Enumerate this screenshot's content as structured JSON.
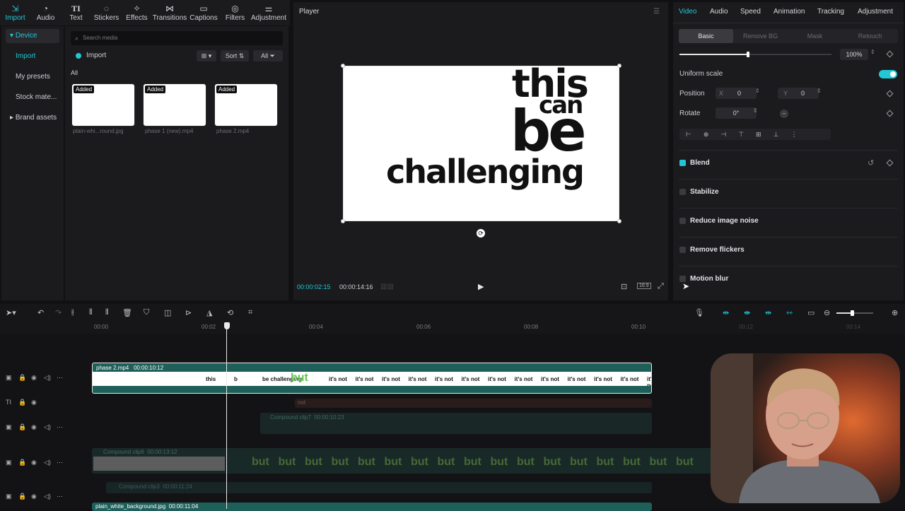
{
  "toolbar": {
    "tabs": [
      {
        "label": "Import",
        "icon": "import-icon"
      },
      {
        "label": "Audio",
        "icon": "audio-icon"
      },
      {
        "label": "Text",
        "icon": "text-icon"
      },
      {
        "label": "Stickers",
        "icon": "stickers-icon"
      },
      {
        "label": "Effects",
        "icon": "effects-icon"
      },
      {
        "label": "Transitions",
        "icon": "transitions-icon"
      },
      {
        "label": "Captions",
        "icon": "captions-icon"
      },
      {
        "label": "Filters",
        "icon": "filters-icon"
      },
      {
        "label": "Adjustment",
        "icon": "adjustment-icon"
      }
    ],
    "active_color": "#22c7d6"
  },
  "sidebar": {
    "items": [
      "Device",
      "Import",
      "My presets",
      "Stock mate...",
      "Brand assets"
    ]
  },
  "media": {
    "search_placeholder": "Search media",
    "import_label": "Import",
    "sort_label": "Sort",
    "all_filter_label": "All",
    "section_label": "All",
    "items": [
      {
        "name": "plain-whi...round.jpg",
        "badge": "Added"
      },
      {
        "name": "phase 1 (new).mp4",
        "badge": "Added"
      },
      {
        "name": "phase 2.mp4",
        "badge": "Added"
      }
    ]
  },
  "player": {
    "title": "Player",
    "current_time": "00:00:02:15",
    "total_time": "00:00:14:16",
    "aspect_label": "16:9",
    "canvas_text": [
      "this",
      "can",
      "be",
      "challenging"
    ]
  },
  "inspector": {
    "tabs": [
      "Video",
      "Audio",
      "Speed",
      "Animation",
      "Tracking",
      "Adjustment"
    ],
    "subtabs": [
      "Basic",
      "Remove BG",
      "Mask",
      "Retouch"
    ],
    "scale_value": "100%",
    "scale_level": 0.45,
    "uniform_scale_label": "Uniform scale",
    "position_label": "Position",
    "position_x_label": "X",
    "position_x": "0",
    "position_y_label": "Y",
    "position_y": "0",
    "rotate_label": "Rotate",
    "rotate_value": "0°",
    "sections": [
      {
        "label": "Blend",
        "checked": true
      },
      {
        "label": "Stabilize",
        "checked": false
      },
      {
        "label": "Reduce image noise",
        "checked": false
      },
      {
        "label": "Remove flickers",
        "checked": false
      },
      {
        "label": "Motion blur",
        "checked": false
      }
    ]
  },
  "timeline": {
    "ruler": [
      "00:00",
      "00:02",
      "00:04",
      "00:06",
      "00:08",
      "00:10",
      "00:12",
      "00:14"
    ],
    "main_clip": {
      "name": "phase 2.mp4",
      "duration": "00:00:10:12"
    },
    "text_clip": "not",
    "compound7": {
      "name": "Compound clip7",
      "duration": "00:00:10:23"
    },
    "compound6": {
      "name": "Compound clip6",
      "duration": "00:00:13:12"
    },
    "compound3": {
      "name": "Compound clip3",
      "duration": "00:00:11:24"
    },
    "bottom_clip": {
      "name": "plain_white_background.jpg",
      "duration": "00:00:11:04"
    },
    "frame_words": [
      "this",
      "b",
      "be challenging",
      "but",
      "it's not",
      "it's not",
      "it's not",
      "it's not",
      "it's not",
      "it's not",
      "it's not",
      "it's not",
      "it's not",
      "it's not",
      "it's not",
      "it's not",
      "it's not"
    ],
    "but_words": [
      "but",
      "but",
      "but",
      "but",
      "but",
      "but",
      "but",
      "but",
      "but",
      "but",
      "but",
      "but",
      "but",
      "but",
      "but",
      "but",
      "but"
    ]
  }
}
